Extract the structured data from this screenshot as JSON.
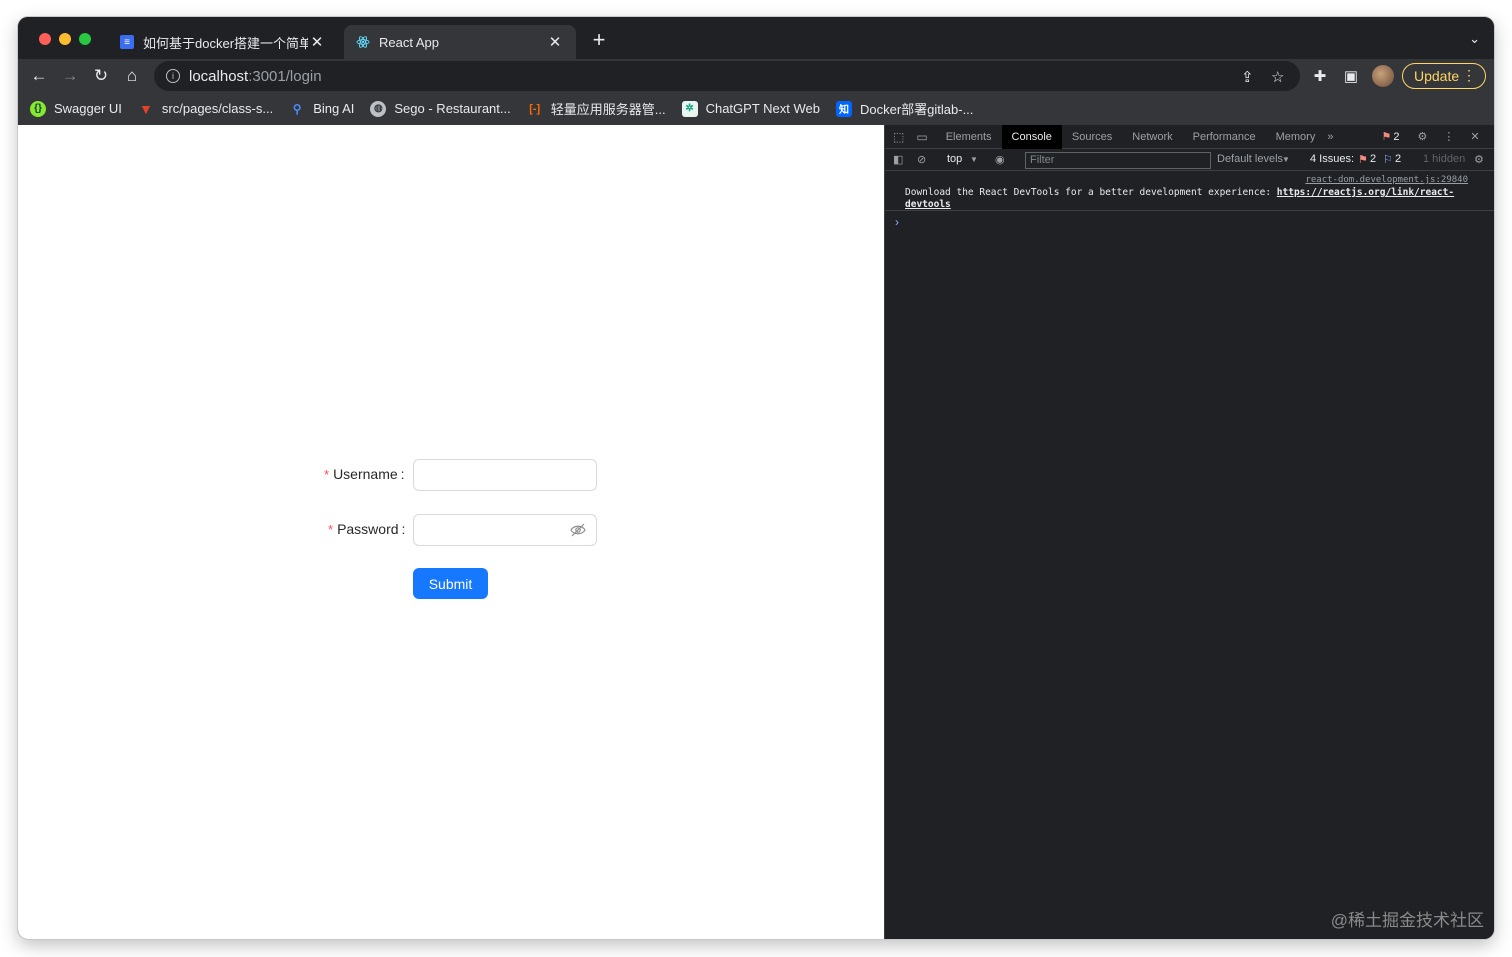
{
  "tabs": [
    {
      "title": "如何基于docker搭建一个简单的全",
      "favicon": "doc-icon",
      "active": false
    },
    {
      "title": "React App",
      "favicon": "react-icon",
      "active": true
    }
  ],
  "toolbar": {
    "url_host": "localhost",
    "url_path": ":3001/login",
    "update_label": "Update"
  },
  "bookmarks": [
    {
      "label": "Swagger UI",
      "icon": "swagger-icon",
      "color": "#85ea2d"
    },
    {
      "label": "src/pages/class-s...",
      "icon": "gitlab-icon",
      "color": "#e24329"
    },
    {
      "label": "Bing AI",
      "icon": "bing-icon",
      "color": "#1a73e8"
    },
    {
      "label": "Sego - Restaurant...",
      "icon": "globe-icon",
      "color": "#bdc1c6"
    },
    {
      "label": "轻量应用服务器管...",
      "icon": "aliyun-icon",
      "color": "#ff6a00"
    },
    {
      "label": "ChatGPT Next Web",
      "icon": "chatgpt-icon",
      "color": "#10a37f"
    },
    {
      "label": "Docker部署gitlab-...",
      "icon": "zhihu-icon",
      "color": "#0066ff"
    }
  ],
  "form": {
    "username_label": "Username",
    "password_label": "Password",
    "required_mark": "*",
    "colon": ":",
    "submit_label": "Submit",
    "username_value": "",
    "password_value": ""
  },
  "devtools": {
    "tabs": [
      "Elements",
      "Console",
      "Sources",
      "Network",
      "Performance",
      "Memory"
    ],
    "active_tab": "Console",
    "error_count": "2",
    "context": "top",
    "filter_placeholder": "Filter",
    "levels": "Default levels",
    "issues_label": "4 Issues:",
    "issues_errors": "2",
    "issues_info": "2",
    "hidden": "1 hidden",
    "console_source": "react-dom.development.js:29840",
    "console_message": "Download the React DevTools for a better development experience: ",
    "console_link": "https://reactjs.org/link/react-devtools"
  },
  "watermark": "@稀土掘金技术社区",
  "colors": {
    "primary": "#1677ff",
    "required": "#ff4d4f",
    "update": "#fdd663"
  }
}
